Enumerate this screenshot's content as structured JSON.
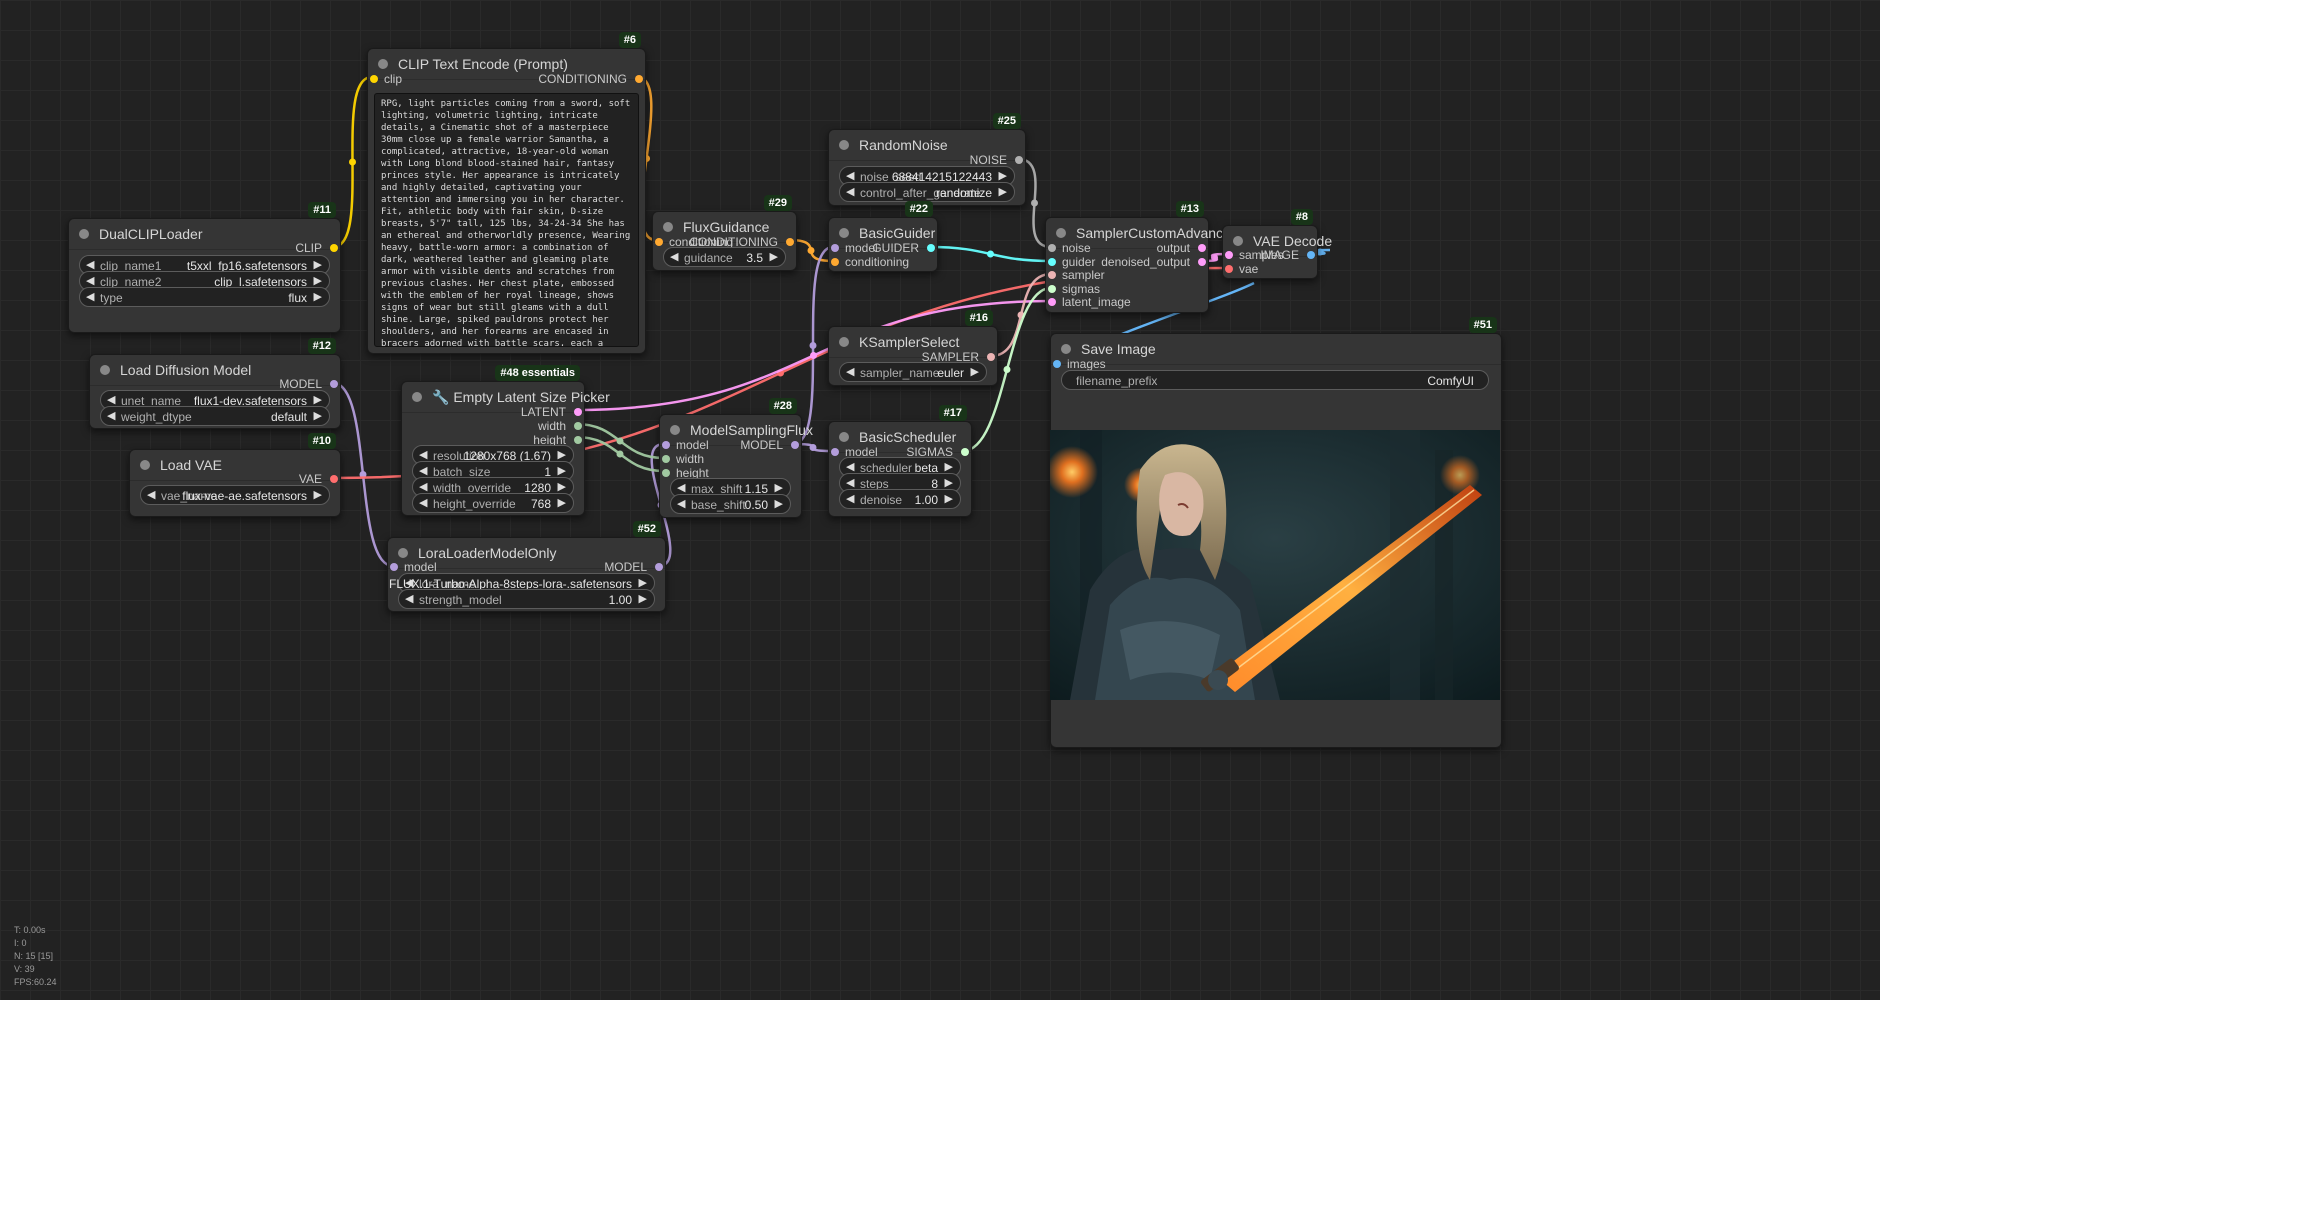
{
  "canvas": {
    "colors": {
      "background": "#222222",
      "grid": "#2a2a2a",
      "node": "#353535",
      "badge": "#183418",
      "link_clip": "#ffd500",
      "link_conditioning": "#ffa931",
      "link_latent": "#ff9cf9",
      "link_model": "#b39ddb",
      "link_vae": "#ff6e6e",
      "link_noise": "#b0b0b0",
      "link_guider": "#66ffff",
      "link_sampler": "#ecb4b4",
      "link_sigmas": "#cdffcd",
      "link_image": "#64b5f6",
      "link_int": "#a1c9a1"
    }
  },
  "nodes": {
    "clip_text_encode": {
      "id": "#6",
      "title": "CLIP Text Encode (Prompt)",
      "input_clip": "clip",
      "output_conditioning": "CONDITIONING",
      "prompt": "RPG, light particles coming from a sword, soft lighting, volumetric lighting, intricate details, a Cinematic shot of a masterpiece 30mm close up a female warrior Samantha, a complicated, attractive, 18-year-old woman with Long blond blood-stained hair, fantasy princes style. Her appearance is intricately and highly detailed, captivating your attention and immersing you in her character. Fit, athletic body with fair skin, D-size breasts, 5'7\" tall, 125 lbs, 34-24-34 She has an ethereal and otherworldly presence, Wearing heavy, battle-worn armor: a combination of dark, weathered leather and gleaming plate armor with visible dents and scratches from previous clashes. Her chest plate, embossed with the emblem of her royal lineage, shows signs of wear but still gleams with a dull shine. Large, spiked pauldrons protect her shoulders, and her forearms are encased in bracers adorned with battle scars, each a testament to the intensity of her past battles. Her lower body is covered by a leather battle skirt reinforced with metal plates, allowing protection and mobility. A large, bloodstained sword is strapped to her back, its hilt engraved with ancient markings. She holds a smaller, battle-worn sword in her right hand. Her left-hand holding up the torch. She wears intricate jewelry, which adds to her regal and mysterious aura. The atmosphere around her is dark and evil, with a cold blue hue accentuating her powerful personality and RPG Theme, at a dark evil castle with fires all around"
    },
    "dual_clip_loader": {
      "id": "#11",
      "title": "DualCLIPLoader",
      "output_clip": "CLIP",
      "widgets": [
        {
          "label": "clip_name1",
          "value": "t5xxl_fp16.safetensors"
        },
        {
          "label": "clip_name2",
          "value": "clip_l.safetensors"
        },
        {
          "label": "type",
          "value": "flux"
        }
      ]
    },
    "load_diffusion_model": {
      "id": "#12",
      "title": "Load Diffusion Model",
      "output_model": "MODEL",
      "widgets": [
        {
          "label": "unet_name",
          "value": "flux1-dev.safetensors"
        },
        {
          "label": "weight_dtype",
          "value": "default"
        }
      ]
    },
    "load_vae": {
      "id": "#10",
      "title": "Load VAE",
      "output_vae": "VAE",
      "widgets": [
        {
          "label": "vae_name",
          "value": "flux-vae-ae.safetensors"
        }
      ]
    },
    "empty_latent": {
      "id": "#48 essentials",
      "title": "Empty Latent Size Picker",
      "icon": "wrench-icon",
      "outputs": [
        "LATENT",
        "width",
        "height"
      ],
      "widgets": [
        {
          "label": "resolution",
          "value": "1280x768 (1.67)"
        },
        {
          "label": "batch_size",
          "value": "1"
        },
        {
          "label": "width_override",
          "value": "1280"
        },
        {
          "label": "height_override",
          "value": "768"
        }
      ]
    },
    "flux_guidance": {
      "id": "#29",
      "title": "FluxGuidance",
      "input_conditioning": "conditioning",
      "output_conditioning": "CONDITIONING",
      "widgets": [
        {
          "label": "guidance",
          "value": "3.5"
        }
      ]
    },
    "model_sampling_flux": {
      "id": "#28",
      "title": "ModelSamplingFlux",
      "inputs": [
        "model",
        "width",
        "height"
      ],
      "output_model": "MODEL",
      "widgets": [
        {
          "label": "max_shift",
          "value": "1.15"
        },
        {
          "label": "base_shift",
          "value": "0.50"
        }
      ]
    },
    "lora_loader": {
      "id": "#52",
      "title": "LoraLoaderModelOnly",
      "input_model": "model",
      "output_model": "MODEL",
      "widgets": [
        {
          "label": "lora_name",
          "value": "FLUX.1-Turbo-Alpha-8steps-lora-.safetensors"
        },
        {
          "label": "strength_model",
          "value": "1.00"
        }
      ]
    },
    "random_noise": {
      "id": "#25",
      "title": "RandomNoise",
      "output_noise": "NOISE",
      "widgets": [
        {
          "label": "noise_seed",
          "value": "688414215122443"
        },
        {
          "label": "control_after_generate",
          "value": "randomize"
        }
      ]
    },
    "basic_guider": {
      "id": "#22",
      "title": "BasicGuider",
      "inputs": [
        "model",
        "conditioning"
      ],
      "output_guider": "GUIDER"
    },
    "ksampler_select": {
      "id": "#16",
      "title": "KSamplerSelect",
      "output_sampler": "SAMPLER",
      "widgets": [
        {
          "label": "sampler_name",
          "value": "euler"
        }
      ]
    },
    "basic_scheduler": {
      "id": "#17",
      "title": "BasicScheduler",
      "input_model": "model",
      "output_sigmas": "SIGMAS",
      "widgets": [
        {
          "label": "scheduler",
          "value": "beta"
        },
        {
          "label": "steps",
          "value": "8"
        },
        {
          "label": "denoise",
          "value": "1.00"
        }
      ]
    },
    "sampler_custom_advanced": {
      "id": "#13",
      "title": "SamplerCustomAdvanced",
      "inputs": [
        "noise",
        "guider",
        "sampler",
        "sigmas",
        "latent_image"
      ],
      "outputs": [
        "output",
        "denoised_output"
      ]
    },
    "vae_decode": {
      "id": "#8",
      "title": "VAE Decode",
      "inputs": [
        "samples",
        "vae"
      ],
      "output_image": "IMAGE"
    },
    "save_image": {
      "id": "#51",
      "title": "Save Image",
      "input_images": "images",
      "widgets": [
        {
          "label": "filename_prefix",
          "value": "ComfyUI"
        }
      ]
    }
  },
  "stats": [
    "T: 0.00s",
    "I: 0",
    "N: 15 [15]",
    "V: 39",
    "FPS:60.24"
  ]
}
